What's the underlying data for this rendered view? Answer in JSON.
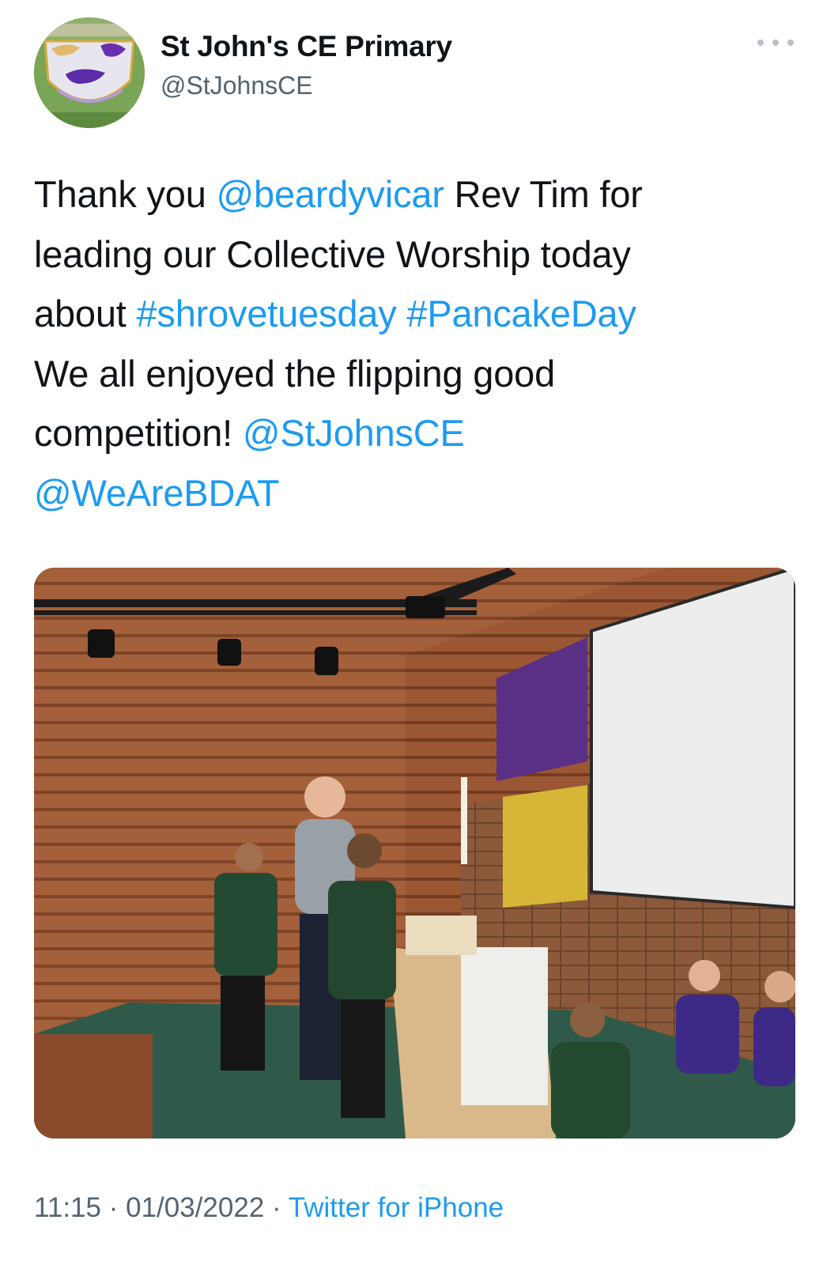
{
  "tweet": {
    "author": {
      "display_name": "St John's CE Primary",
      "handle": "@StJohnsCE",
      "avatar_icon": "school-badge-avatar"
    },
    "more_icon": "more-options-icon",
    "text_lines": [
      [
        {
          "text": "Thank you ",
          "type": "text"
        },
        {
          "text": "@beardyvicar",
          "type": "mention"
        },
        {
          "text": " Rev Tim for",
          "type": "text"
        }
      ],
      [
        {
          "text": "leading our Collective Worship today",
          "type": "text"
        }
      ],
      [
        {
          "text": "about ",
          "type": "text"
        },
        {
          "text": "#shrovetuesday",
          "type": "hashtag"
        },
        {
          "text": " ",
          "type": "text"
        },
        {
          "text": "#PancakeDay",
          "type": "hashtag"
        }
      ],
      [
        {
          "text": "We all enjoyed the flipping good",
          "type": "text"
        }
      ],
      [
        {
          "text": "competition! ",
          "type": "text"
        },
        {
          "text": "@StJohnsCE",
          "type": "mention"
        }
      ],
      [
        {
          "text": "@WeAreBDAT",
          "type": "mention"
        }
      ]
    ],
    "meta": {
      "time": "11:15",
      "date": "01/03/2022",
      "separator": "·",
      "source": "Twitter for iPhone"
    }
  },
  "colors": {
    "link": "#1d9bf0",
    "text": "#0f1419",
    "secondary": "#536471"
  }
}
